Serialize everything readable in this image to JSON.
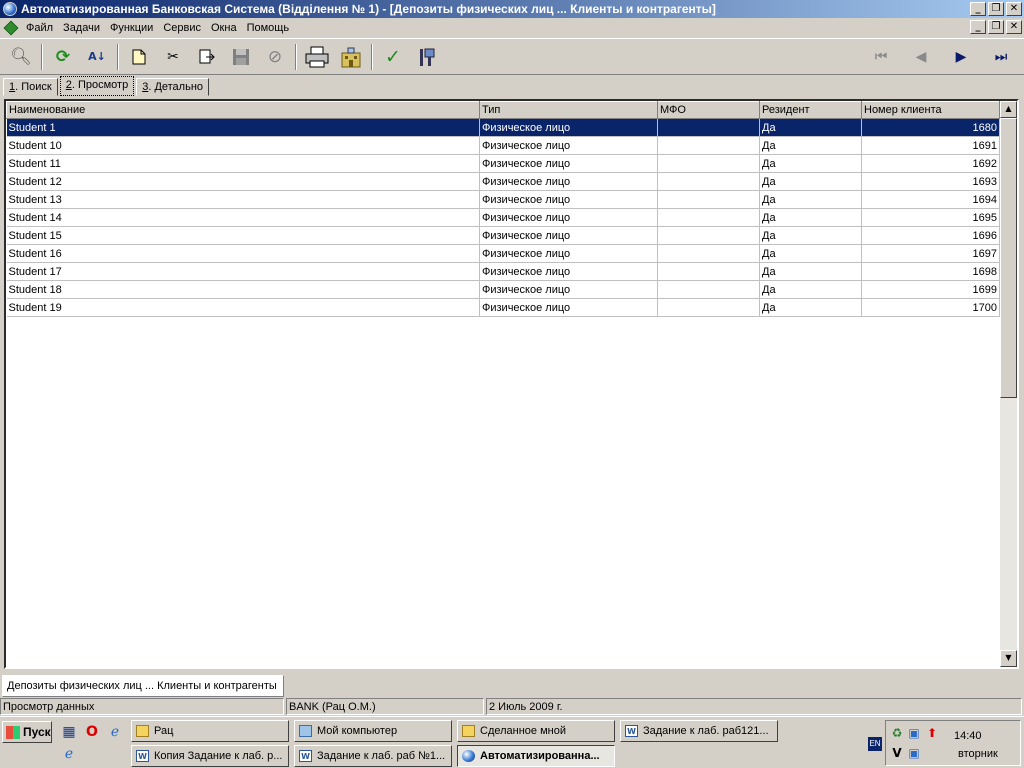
{
  "window": {
    "title": "Автоматизированная Банковская Система (Відділення № 1) - [Депозиты физических лиц ... Клиенты и контрагенты]",
    "btn_minimize": "_",
    "btn_restore": "❐",
    "btn_close": "✕"
  },
  "menu": {
    "items": [
      "Файл",
      "Задачи",
      "Функции",
      "Сервис",
      "Окна",
      "Помощь"
    ]
  },
  "toolbar": {
    "icons": [
      "magnifier-icon",
      "refresh-icon",
      "sort-az-icon",
      "new-document-icon",
      "find-replace-icon",
      "export-icon",
      "save-icon",
      "cancel-icon",
      "print-icon",
      "building-icon",
      "checkmark-icon",
      "flag-icon"
    ],
    "nav_icons": [
      "first-record-icon",
      "previous-record-icon",
      "next-record-icon",
      "last-record-icon"
    ]
  },
  "tabs": [
    {
      "num": "1",
      "label": ". Поиск"
    },
    {
      "num": "2",
      "label": ". Просмотр"
    },
    {
      "num": "3",
      "label": ". Детально"
    }
  ],
  "grid": {
    "columns": [
      "Наименование",
      "Тип",
      "МФО",
      "Резидент",
      "Номер клиента"
    ],
    "rows": [
      [
        "Student 1",
        "Физическое лицо",
        "",
        "Да",
        "1680"
      ],
      [
        "Student 10",
        "Физическое лицо",
        "",
        "Да",
        "1691"
      ],
      [
        "Student 11",
        "Физическое лицо",
        "",
        "Да",
        "1692"
      ],
      [
        "Student 12",
        "Физическое лицо",
        "",
        "Да",
        "1693"
      ],
      [
        "Student 13",
        "Физическое лицо",
        "",
        "Да",
        "1694"
      ],
      [
        "Student 14",
        "Физическое лицо",
        "",
        "Да",
        "1695"
      ],
      [
        "Student 15",
        "Физическое лицо",
        "",
        "Да",
        "1696"
      ],
      [
        "Student 16",
        "Физическое лицо",
        "",
        "Да",
        "1697"
      ],
      [
        "Student 17",
        "Физическое лицо",
        "",
        "Да",
        "1698"
      ],
      [
        "Student 18",
        "Физическое лицо",
        "",
        "Да",
        "1699"
      ],
      [
        "Student 19",
        "Физическое лицо",
        "",
        "Да",
        "1700"
      ]
    ],
    "selected_row": 0
  },
  "document_tab": "Депозиты физических лиц ... Клиенты и контрагенты",
  "status": {
    "mode": "Просмотр данных",
    "user": "BANK (Рац О.М.)",
    "date": "2 Июль 2009 г."
  },
  "taskbar": {
    "start_label": "Пуск",
    "buttons_top": [
      "Рац",
      "Мой компьютер",
      "Сделанное мной",
      "Задание к лаб. раб121..."
    ],
    "buttons_bottom": [
      "Копия Задание к лаб. р...",
      "Задание к лаб. раб №1...",
      "Автоматизированна..."
    ],
    "lang": "EN",
    "clock_time": "14:40",
    "clock_day": "вторник"
  },
  "colors": {
    "title_start": "#0a246a",
    "title_end": "#a6caf0",
    "selection": "#0a246a",
    "chrome": "#d4d0c8"
  }
}
